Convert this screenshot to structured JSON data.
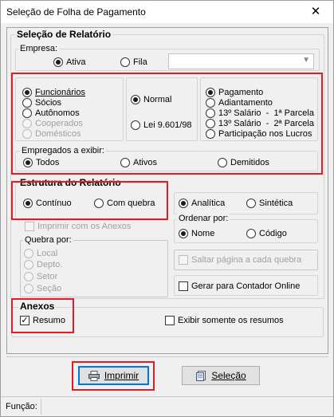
{
  "window": {
    "title": "Seleção de Folha de Pagamento",
    "close_symbol": "✕"
  },
  "relatorio": {
    "legend": "Seleção de Relatório",
    "empresa": {
      "legend": "Empresa:",
      "ativa": "Ativa",
      "fila": "Fila",
      "combo_value": "",
      "selected": "Ativa"
    },
    "tipo_pessoa": {
      "options": [
        "Funcionários",
        "Sócios",
        "Autônomos",
        "Cooperados",
        "Domésticos"
      ],
      "disabled": [
        "Cooperados",
        "Domésticos"
      ],
      "selected": "Funcionários"
    },
    "regime": {
      "options": [
        "Normal",
        "Lei 9.601/98"
      ],
      "selected": "Normal"
    },
    "tipo_folha": {
      "options": [
        "Pagamento",
        "Adiantamento",
        "13º Salário  -  1ª Parcela",
        "13º Salário  -  2ª Parcela",
        "Participação nos Lucros"
      ],
      "selected": "Pagamento"
    },
    "empregados": {
      "legend": "Empregados a exibir:",
      "options": [
        "Todos",
        "Ativos",
        "Demitidos"
      ],
      "selected": "Todos"
    }
  },
  "estrutura": {
    "legend": "Estrutura do Relatório",
    "options": [
      "Contínuo",
      "Com quebra"
    ],
    "selected": "Contínuo",
    "imprimir_anexos": "Imprimir com os Anexos",
    "quebra": {
      "legend": "Quebra por:",
      "options": [
        "Local",
        "Depto.",
        "Setor",
        "Seção"
      ]
    }
  },
  "apresentacao": {
    "options": [
      "Analítica",
      "Sintética"
    ],
    "selected": "Analítica"
  },
  "ordenar": {
    "legend": "Ordenar por:",
    "options": [
      "Nome",
      "Código"
    ],
    "selected": "Nome"
  },
  "saltar_pagina": "Saltar página a cada quebra",
  "gerar_contador": "Gerar para Contador Online",
  "anexos": {
    "legend": "Anexos",
    "resumo": "Resumo",
    "resumo_checked": true,
    "exibir_somente": "Exibir somente os resumos",
    "check_symbol": "✓"
  },
  "buttons": {
    "imprimir": "Imprimir",
    "selecao": "Seleção"
  },
  "status": {
    "funcao_label": "Função:"
  },
  "colors": {
    "highlight": "#e21c26",
    "default_button_border": "#0078d7"
  }
}
